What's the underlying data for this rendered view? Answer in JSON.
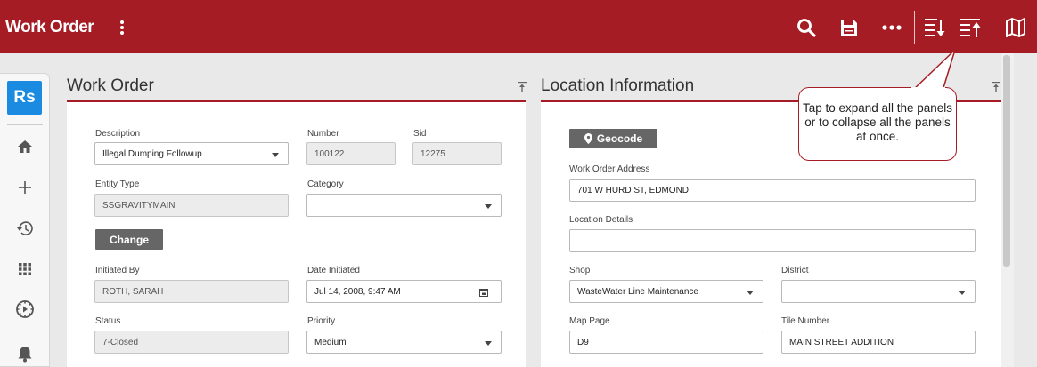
{
  "header": {
    "title": "Work Order"
  },
  "sidebar": {
    "logo": "Rs"
  },
  "work_order_panel": {
    "title": "Work Order",
    "description_label": "Description",
    "description_value": "Illegal Dumping Followup",
    "number_label": "Number",
    "number_value": "100122",
    "sid_label": "Sid",
    "sid_value": "12275",
    "entity_type_label": "Entity Type",
    "entity_type_value": "SSGRAVITYMAIN",
    "category_label": "Category",
    "category_value": "",
    "change_button": "Change",
    "initiated_by_label": "Initiated By",
    "initiated_by_value": "ROTH, SARAH",
    "date_initiated_label": "Date Initiated",
    "date_initiated_value": "Jul 14, 2008, 9:47 AM",
    "status_label": "Status",
    "status_value": "7-Closed",
    "priority_label": "Priority",
    "priority_value": "Medium"
  },
  "location_panel": {
    "title": "Location Information",
    "geocode_button": "Geocode",
    "address_label": "Work Order Address",
    "address_value": "701 W HURD ST,  EDMOND",
    "location_details_label": "Location Details",
    "location_details_value": "",
    "shop_label": "Shop",
    "shop_value": "WasteWater Line Maintenance",
    "district_label": "District",
    "district_value": "",
    "map_page_label": "Map Page",
    "map_page_value": "D9",
    "tile_number_label": "Tile Number",
    "tile_number_value": "MAIN STREET ADDITION"
  },
  "callout": {
    "text": "Tap to expand all the panels or to collapse all the panels at once."
  },
  "colors": {
    "brand": "#a51c24",
    "logo": "#1a8be0"
  },
  "icons": [
    "kebab-menu-icon",
    "search-icon",
    "save-icon",
    "more-icon",
    "expand-all-icon",
    "collapse-all-icon",
    "map-icon",
    "home-icon",
    "plus-icon",
    "history-icon",
    "apps-icon",
    "workflow-icon",
    "bell-icon",
    "calendar-icon",
    "map-marker-icon"
  ]
}
